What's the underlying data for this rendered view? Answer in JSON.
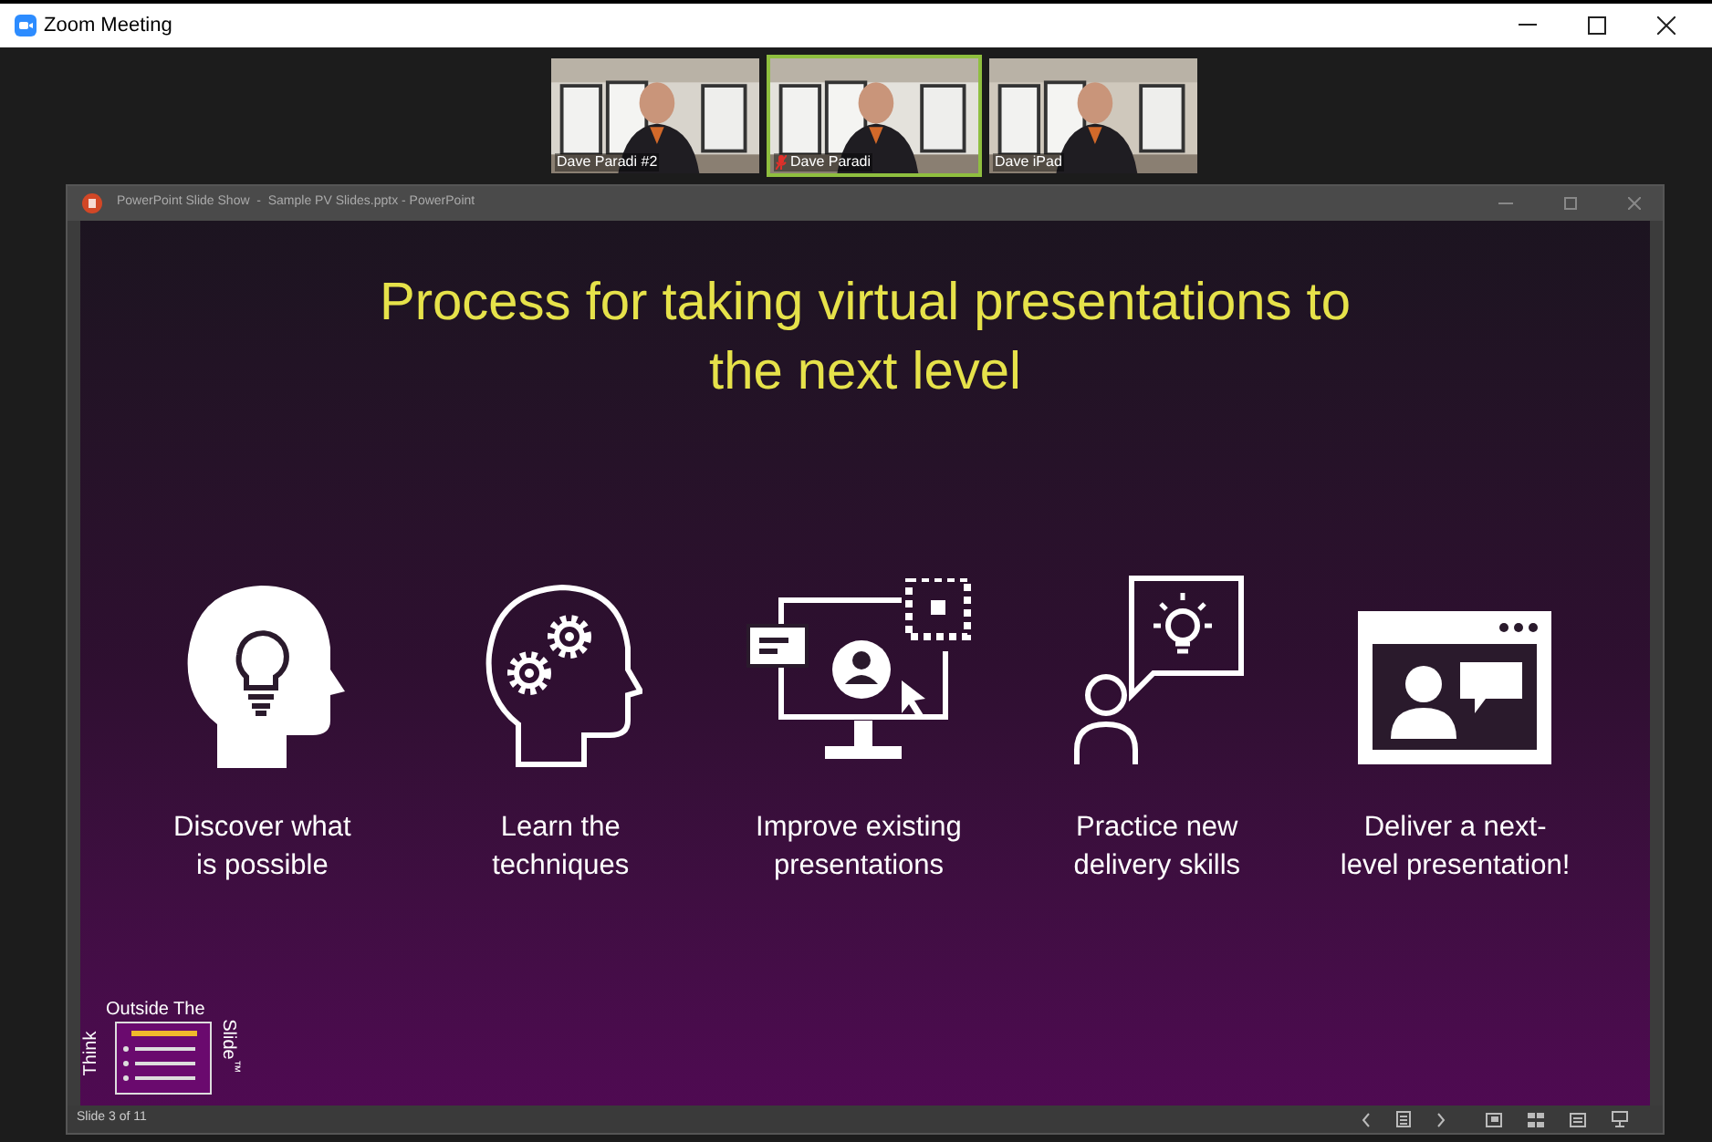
{
  "window": {
    "title": "Zoom Meeting"
  },
  "videos": [
    {
      "name": "Dave Paradi #2",
      "selected": false,
      "muted": false
    },
    {
      "name": "Dave Paradi",
      "selected": true,
      "muted": true
    },
    {
      "name": "Dave iPad",
      "selected": false,
      "muted": false
    }
  ],
  "presentation_window": {
    "title": "PowerPoint Slide Show  -  Sample PV Slides.pptx - PowerPoint",
    "slide": {
      "title": "Process for taking virtual presentations to the next level",
      "steps": [
        {
          "kind": "head-bulb",
          "label": "Discover what\nis possible"
        },
        {
          "kind": "head-gears",
          "label": "Learn the\ntechniques"
        },
        {
          "kind": "monitor",
          "label": "Improve existing\npresentations"
        },
        {
          "kind": "speech-person",
          "label": "Practice new\ndelivery skills"
        },
        {
          "kind": "video-call",
          "label": "Deliver a next-\nlevel presentation!"
        }
      ],
      "logo": {
        "left": "Think",
        "top": "Outside The",
        "right": "Slide$^{™}$"
      }
    },
    "status_bar": {
      "slide_counter": "Slide 3 of 11"
    }
  }
}
